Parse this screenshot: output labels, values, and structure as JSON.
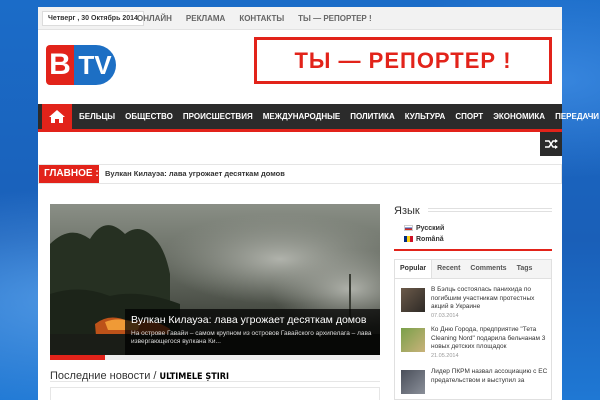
{
  "colors": {
    "accent": "#e2231a",
    "nav_bg": "#2b2b2b",
    "page_bg": "#1d6fc4"
  },
  "topbar": {
    "date": "Четверг , 30 Октябрь 2014",
    "links": [
      "ОНЛАЙН",
      "РЕКЛАМА",
      "КОНТАКТЫ",
      "ТЫ — РЕПОРТЕР !"
    ]
  },
  "header": {
    "logo": {
      "b": "B",
      "tv": "TV"
    },
    "banner": "ТЫ — РЕПОРТЕР !"
  },
  "nav": {
    "home_icon": "home-icon",
    "items": [
      "БЕЛЬЦЫ",
      "ОБЩЕСТВО",
      "ПРОИСШЕСТВИЯ",
      "МЕЖДУНАРОДНЫЕ",
      "ПОЛИТИКА",
      "КУЛЬТУРА",
      "СПОРТ",
      "ЭКОНОМИКА",
      "ПЕРЕДАЧИ"
    ],
    "dropdown_icon": "chevron-down-icon",
    "shuffle_icon": "shuffle-icon"
  },
  "breaking": {
    "label": "ГЛАВНОЕ :",
    "text": "Вулкан Килауэа: лава угрожает десяткам домов"
  },
  "slider": {
    "title": "Вулкан Килауэа: лава угрожает десяткам домов",
    "excerpt": "На острове Гавайи – самом крупном из островов Гавайского архипелага – лава извергающегося вулкана Ки..."
  },
  "latest": {
    "title": "Последние новости / ",
    "title_bold": "ULTIMELE ȘTIRI"
  },
  "sidebar": {
    "lang_title": "Язык",
    "languages": [
      {
        "label": "Русский",
        "flag": "ru"
      },
      {
        "label": "Română",
        "flag": "ro"
      }
    ],
    "tabs": [
      "Popular",
      "Recent",
      "Comments",
      "Tags"
    ],
    "active_tab": "Popular",
    "posts": [
      {
        "title": "В Бэлць состоялась панихида по погибшим участникам протестных акций в Украине",
        "date": "07.03.2014"
      },
      {
        "title": "Ко Дню Города, предприятие \"Тета Cleaning Nord\" подарила бельчанам 3 новых детских площадок",
        "date": "21.05.2014"
      },
      {
        "title": "Лидер ПКРМ назвал ассоциацию с ЕС предательством и выступил за",
        "date": ""
      }
    ]
  }
}
